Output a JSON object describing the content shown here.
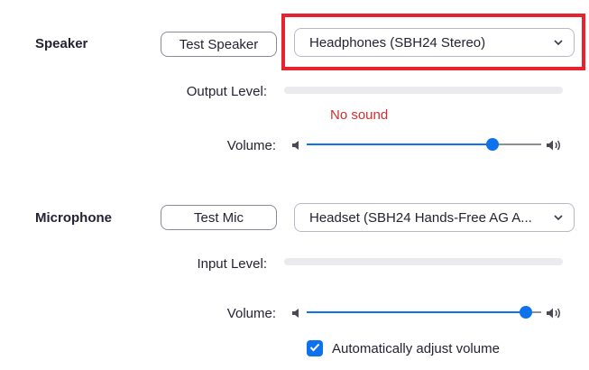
{
  "speaker": {
    "section_label": "Speaker",
    "test_button_label": "Test Speaker",
    "device_selected": "Headphones (SBH24 Stereo)",
    "output_level_label": "Output Level:",
    "status_text": "No sound",
    "volume_label": "Volume:",
    "volume_level": 0.81
  },
  "microphone": {
    "section_label": "Microphone",
    "test_button_label": "Test Mic",
    "device_selected": "Headset (SBH24 Hands-Free AG A...",
    "input_level_label": "Input Level:",
    "volume_label": "Volume:",
    "volume_level": 0.96,
    "auto_adjust_checked": true,
    "auto_adjust_label": "Automatically adjust volume"
  },
  "colors": {
    "accent": "#0e72ed",
    "highlight_box": "#e8222e",
    "status_red": "#d12f2f"
  },
  "icons": {
    "dropdown": "chevron-down-icon",
    "volume_low": "volume-low-icon",
    "volume_high": "volume-high-icon",
    "checkbox": "checkmark-icon"
  }
}
